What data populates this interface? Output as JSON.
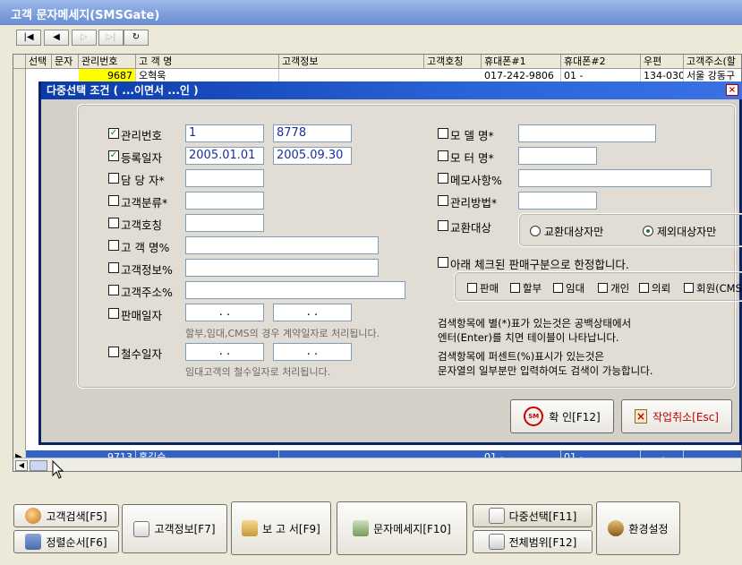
{
  "window": {
    "title": "고객 문자메세지(SMSGate)"
  },
  "nav": [
    "|◀",
    "◀",
    "▷",
    "▷|",
    "↻"
  ],
  "grid": {
    "headers": [
      "선택",
      "문자",
      "관리번호",
      "고 객 명",
      "고객정보",
      "고객호칭",
      "휴대폰#1",
      "휴대폰#2",
      "우편",
      "고객주소(할"
    ],
    "row1": {
      "num": "9687",
      "name": "오혁욱",
      "phone1": "017-242-9806",
      "phone2": "01 -",
      "zip": "134-030",
      "addr": "서울 강동구"
    },
    "row_sel": {
      "marker": "▶",
      "num": "9713",
      "name": "홍길순",
      "phone1": "01 -",
      "phone2": "01 -",
      "zip": "-"
    }
  },
  "dialog": {
    "title": "다중선택 조건 ( ...이면서 ...인 )",
    "close": "×",
    "left": {
      "mgmt": {
        "label": "관리번호",
        "checked": "✓",
        "from": "1",
        "to": "8778"
      },
      "reg": {
        "label": "등록일자",
        "checked": "✓",
        "from": "2005.01.01",
        "to": "2005.09.30"
      },
      "staff": {
        "label": "담 당 자*"
      },
      "cat": {
        "label": "고객분류*"
      },
      "title": {
        "label": "고객호칭"
      },
      "name": {
        "label": "고 객 명%"
      },
      "info": {
        "label": "고객정보%"
      },
      "addr": {
        "label": "고객주소%"
      },
      "sale": {
        "label": "판매일자",
        "from": ". .",
        "to": ". .",
        "hint": "할부,임대,CMS의 경우 계약일자로 처리됩니다."
      },
      "withdraw": {
        "label": "철수일자",
        "from": ". .",
        "to": ". .",
        "hint": "임대고객의 철수일자로 처리됩니다."
      }
    },
    "right": {
      "model": {
        "label": "모 델 명*"
      },
      "motor": {
        "label": "모 터 명*"
      },
      "memo": {
        "label": "메모사항%"
      },
      "method": {
        "label": "관리방법*"
      },
      "exchange": {
        "label": "교환대상",
        "opt1": "교환대상자만",
        "opt2": "제외대상자만"
      },
      "limit": {
        "label": "아래 체크된 판매구분으로 한정합니다."
      },
      "kinds": [
        "판매",
        "할부",
        "임대",
        "개인",
        "의뢰",
        "회원(CMS)"
      ],
      "info1": "검색항목에 별(*)표가 있는것은 공백상태에서",
      "info2": "엔터(Enter)를 치면 테이블이 나타납니다.",
      "info3": "검색항목에 퍼센트(%)표시가 있는것은",
      "info4": "문자열의 일부분만 입력하여도 검색이 가능합니다."
    },
    "ok": "확  인[F12]",
    "cancel": "작업취소[Esc]"
  },
  "buttons": {
    "search": "고객검색[F5]",
    "sort": "정렬순서[F6]",
    "info": "고객정보[F7]",
    "report": "보 고 서[F9]",
    "sms": "문자메세지[F10]",
    "multi": "다중선택[F11]",
    "range": "전체범위[F12]",
    "settings": "환경설정"
  },
  "colors": {
    "accent": "#0a246a",
    "cancel_text": "#c00000",
    "highlight": "#ffff00",
    "selected_row": "#3163c5"
  }
}
